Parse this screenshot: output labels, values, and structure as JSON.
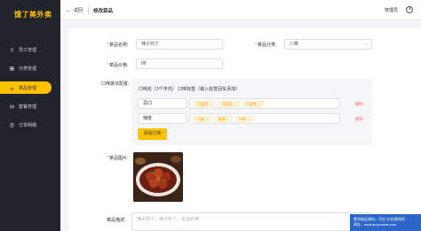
{
  "sidebar": {
    "brand": "饿了美外卖",
    "items": [
      {
        "label": "员工管理",
        "icon": "staff-icon"
      },
      {
        "label": "分类管理",
        "icon": "category-icon"
      },
      {
        "label": "菜品管理",
        "icon": "dish-icon",
        "active": true
      },
      {
        "label": "套餐管理",
        "icon": "combo-icon"
      },
      {
        "label": "订单明细",
        "icon": "order-icon"
      }
    ]
  },
  "topbar": {
    "back_label": "返回",
    "title": "修改菜品",
    "admin_label": "管理员"
  },
  "form": {
    "name_label": "菜品名称:",
    "name_value": "辣子鸡丁",
    "category_label": "菜品分类:",
    "category_value": "川菜",
    "price_label": "菜品价格:",
    "price_value": "88",
    "flavor_label": "口味做法配置:",
    "flavor_header": "口味名（3个字内） 口味标签（输入标签回车添加）",
    "flavors": [
      {
        "name": "忌口",
        "tags": [
          "不要葱",
          "不要蒜",
          "不要辣"
        ],
        "delete_label": "删除"
      },
      {
        "name": "辣度",
        "tags": [
          "不辣",
          "微辣",
          "中辣"
        ],
        "delete_label": "删除"
      }
    ],
    "add_flavor_label": "添加口味",
    "image_label": "菜品图片:",
    "desc_label": "菜品描述:",
    "desc_value": "辣子鸡丁，辣子鸡丁，永远的神"
  },
  "watermark": {
    "line1": "更多精品源码，尽在\"从优源码网\"",
    "line2": "网址：www.ymycodes.com"
  },
  "colors": {
    "accent": "#ffc200",
    "sidebar_bg": "#22242b",
    "danger": "#f56c6c"
  }
}
